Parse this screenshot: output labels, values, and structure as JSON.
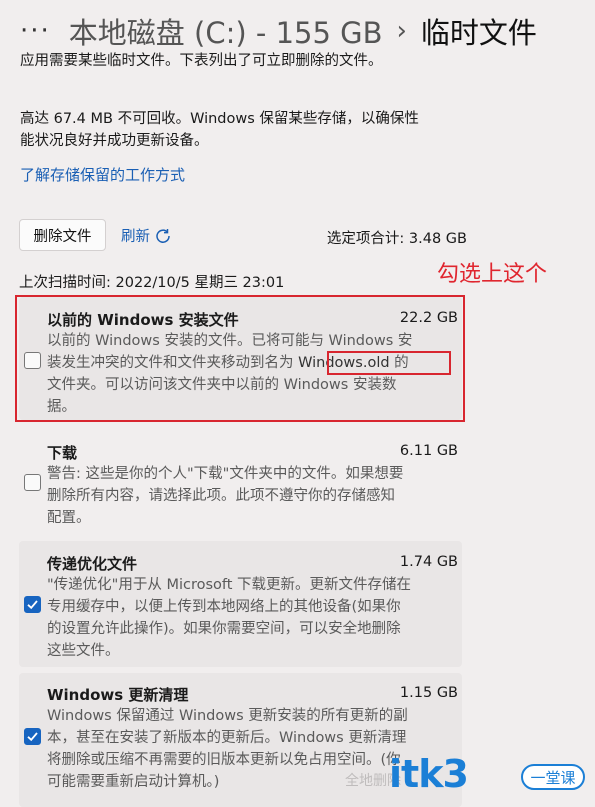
{
  "header": {
    "more_label": "···",
    "drive": "本地磁盘 (C:) - 155 GB",
    "separator": "›",
    "current": "临时文件"
  },
  "intro": {
    "line1": "应用需要某些临时文件。下表列出了可立即删除的文件。",
    "line2a": "高达 67.4 MB 不可回收。Windows 保留某些存储，以确保性",
    "line2b": "能状况良好并成功更新设备。",
    "learn_link": "了解存储保留的工作方式"
  },
  "toolbar": {
    "delete_label": "删除文件",
    "refresh_label": "刷新",
    "selected_total": "选定项合计: 3.48 GB",
    "last_scan": "上次扫描时间: 2022/10/5 星期三 23:01"
  },
  "annotation": {
    "text": "勾选上这个",
    "color": "#e0262f"
  },
  "items": [
    {
      "title": "以前的 Windows 安装文件",
      "size": "22.2 GB",
      "checked": false,
      "desc": [
        "以前的 Windows 安装的文件。已将可能与 Windows 安",
        "装发生冲突的文件和文件夹移动到名为 ",
        "Windows.old",
        " 的",
        "文件夹。可以访问该文件夹中以前的 Windows 安装数",
        "据。"
      ]
    },
    {
      "title": "下载",
      "size": "6.11 GB",
      "checked": false,
      "desc": [
        "警告: 这些是你的个人\"下载\"文件夹中的文件。如果想要",
        "删除所有内容，请选择此项。此项不遵守你的存储感知",
        "配置。"
      ]
    },
    {
      "title": "传递优化文件",
      "size": "1.74 GB",
      "checked": true,
      "desc": [
        "\"传递优化\"用于从 Microsoft 下载更新。更新文件存储在",
        "专用缓存中，以便上传到本地网络上的其他设备(如果你",
        "的设置允许此操作)。如果你需要空间，可以安全地删除",
        "这些文件。"
      ]
    },
    {
      "title": "Windows 更新清理",
      "size": "1.15 GB",
      "checked": true,
      "desc": [
        "Windows 保留通过 Windows 更新安装的所有更新的副",
        "本，甚至在安装了新版本的更新后。Windows 更新清理",
        "将删除或压缩不再需要的旧版本更新以免占用空间。(你",
        "可能需要重新启动计算机。)"
      ]
    }
  ],
  "watermark": {
    "brand": "itk3",
    "badge": "一堂课",
    "faint": "全地删除"
  },
  "colors": {
    "background": "#f1eeee",
    "accent": "#1764c0",
    "link": "#1a5fb4",
    "highlight": "#d8262f"
  }
}
